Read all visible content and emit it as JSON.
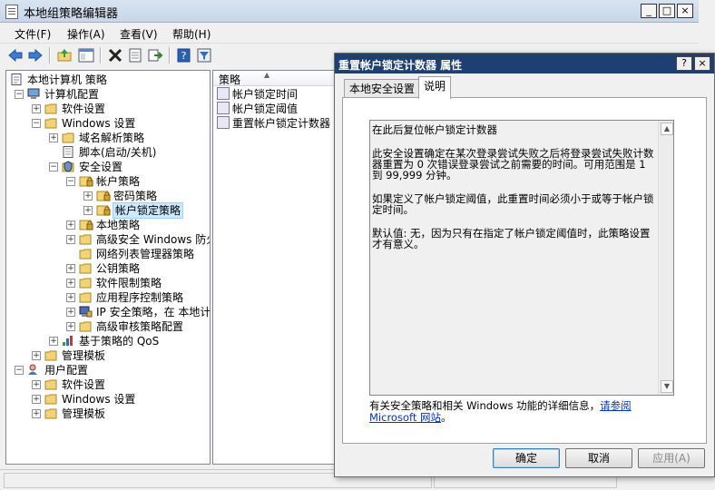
{
  "window": {
    "title": "本地组策略编辑器"
  },
  "menu": [
    "文件(F)",
    "操作(A)",
    "查看(V)",
    "帮助(H)"
  ],
  "toolbar": {
    "icons": [
      "back-icon",
      "forward-icon",
      "up-icon",
      "show-hide-tree-icon",
      "delete-icon",
      "properties-icon",
      "export-icon",
      "help-icon",
      "filter-icon"
    ]
  },
  "tree": [
    {
      "label": "本地计算机 策略",
      "depth": 0,
      "exp": "",
      "icon": "computer-policy"
    },
    {
      "label": "计算机配置",
      "depth": 1,
      "exp": "−",
      "icon": "computer"
    },
    {
      "label": "软件设置",
      "depth": 2,
      "exp": "+",
      "icon": "folder"
    },
    {
      "label": "Windows 设置",
      "depth": 2,
      "exp": "−",
      "icon": "folder"
    },
    {
      "label": "域名解析策略",
      "depth": 3,
      "exp": "+",
      "icon": "folder"
    },
    {
      "label": "脚本(启动/关机)",
      "depth": 3,
      "exp": "",
      "icon": "script"
    },
    {
      "label": "安全设置",
      "depth": 3,
      "exp": "−",
      "icon": "security"
    },
    {
      "label": "帐户策略",
      "depth": 4,
      "exp": "−",
      "icon": "folder-lock"
    },
    {
      "label": "密码策略",
      "depth": 5,
      "exp": "+",
      "icon": "folder-lock"
    },
    {
      "label": "帐户锁定策略",
      "depth": 5,
      "exp": "+",
      "icon": "folder-lock",
      "selected": true
    },
    {
      "label": "本地策略",
      "depth": 4,
      "exp": "+",
      "icon": "folder-lock"
    },
    {
      "label": "高级安全 Windows 防火墙",
      "depth": 4,
      "exp": "+",
      "icon": "folder"
    },
    {
      "label": "网络列表管理器策略",
      "depth": 4,
      "exp": "",
      "icon": "folder"
    },
    {
      "label": "公钥策略",
      "depth": 4,
      "exp": "+",
      "icon": "folder"
    },
    {
      "label": "软件限制策略",
      "depth": 4,
      "exp": "+",
      "icon": "folder"
    },
    {
      "label": "应用程序控制策略",
      "depth": 4,
      "exp": "+",
      "icon": "folder"
    },
    {
      "label": "IP 安全策略，在 本地计算机",
      "depth": 4,
      "exp": "+",
      "icon": "ipsec"
    },
    {
      "label": "高级审核策略配置",
      "depth": 4,
      "exp": "+",
      "icon": "folder"
    },
    {
      "label": "基于策略的 QoS",
      "depth": 3,
      "exp": "+",
      "icon": "chart"
    },
    {
      "label": "管理模板",
      "depth": 2,
      "exp": "+",
      "icon": "folder"
    },
    {
      "label": "用户配置",
      "depth": 1,
      "exp": "−",
      "icon": "user"
    },
    {
      "label": "软件设置",
      "depth": 2,
      "exp": "+",
      "icon": "folder"
    },
    {
      "label": "Windows 设置",
      "depth": 2,
      "exp": "+",
      "icon": "folder"
    },
    {
      "label": "管理模板",
      "depth": 2,
      "exp": "+",
      "icon": "folder"
    }
  ],
  "list": {
    "column": "策略",
    "items": [
      "帐户锁定时间",
      "帐户锁定阈值",
      "重置帐户锁定计数器"
    ]
  },
  "dialog": {
    "title": "重置帐户锁定计数器 属性",
    "tabs": [
      "本地安全设置",
      "说明"
    ],
    "active_tab": 1,
    "heading": "在此后复位帐户锁定计数器",
    "para1": "此安全设置确定在某次登录尝试失败之后将登录尝试失败计数器重置为 0 次错误登录尝试之前需要的时间。可用范围是 1 到 99,999 分钟。",
    "para2": "如果定义了帐户锁定阈值，此重置时间必须小于或等于帐户锁定时间。",
    "para3": "默认值: 无，因为只有在指定了帐户锁定阈值时，此策略设置才有意义。",
    "more_prefix": "有关安全策略和相关 Windows 功能的详细信息，",
    "more_link": "请参阅 Microsoft 网站",
    "more_suffix": "。",
    "ok": "确定",
    "cancel": "取消",
    "apply": "应用(A)"
  }
}
